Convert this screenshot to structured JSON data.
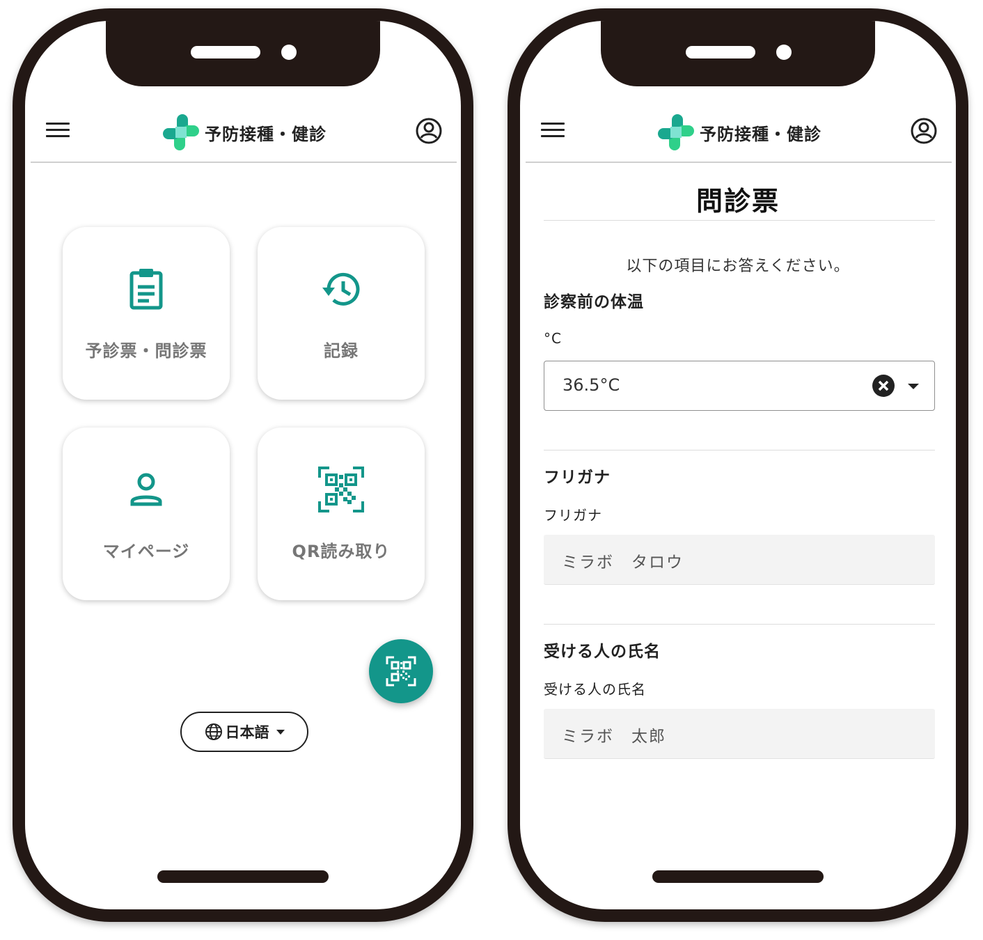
{
  "app": {
    "title": "予防接種・健診"
  },
  "home": {
    "tiles": [
      {
        "label": "予診票・問診票",
        "icon": "clipboard-icon"
      },
      {
        "label": "記録",
        "icon": "history-icon"
      },
      {
        "label": "マイページ",
        "icon": "person-icon"
      },
      {
        "label": "QR読み取り",
        "icon": "qr-code-icon"
      }
    ],
    "fab_icon": "qr-scan-icon",
    "language": {
      "label": "日本語",
      "icon": "globe-icon"
    }
  },
  "form": {
    "title": "問診票",
    "intro": "以下の項目にお答えください。",
    "temperature": {
      "heading": "診察前の体温",
      "label": "°C",
      "value": "36.5°C"
    },
    "furigana": {
      "heading": "フリガナ",
      "label": "フリガナ",
      "value": "ミラボ　タロウ"
    },
    "recipient_name": {
      "heading": "受ける人の氏名",
      "label": "受ける人の氏名",
      "value": "ミラボ　太郎"
    }
  },
  "colors": {
    "accent": "#13968a",
    "logo_teal": "#1aa88f",
    "logo_green": "#2fd08a",
    "frame": "#231815"
  }
}
